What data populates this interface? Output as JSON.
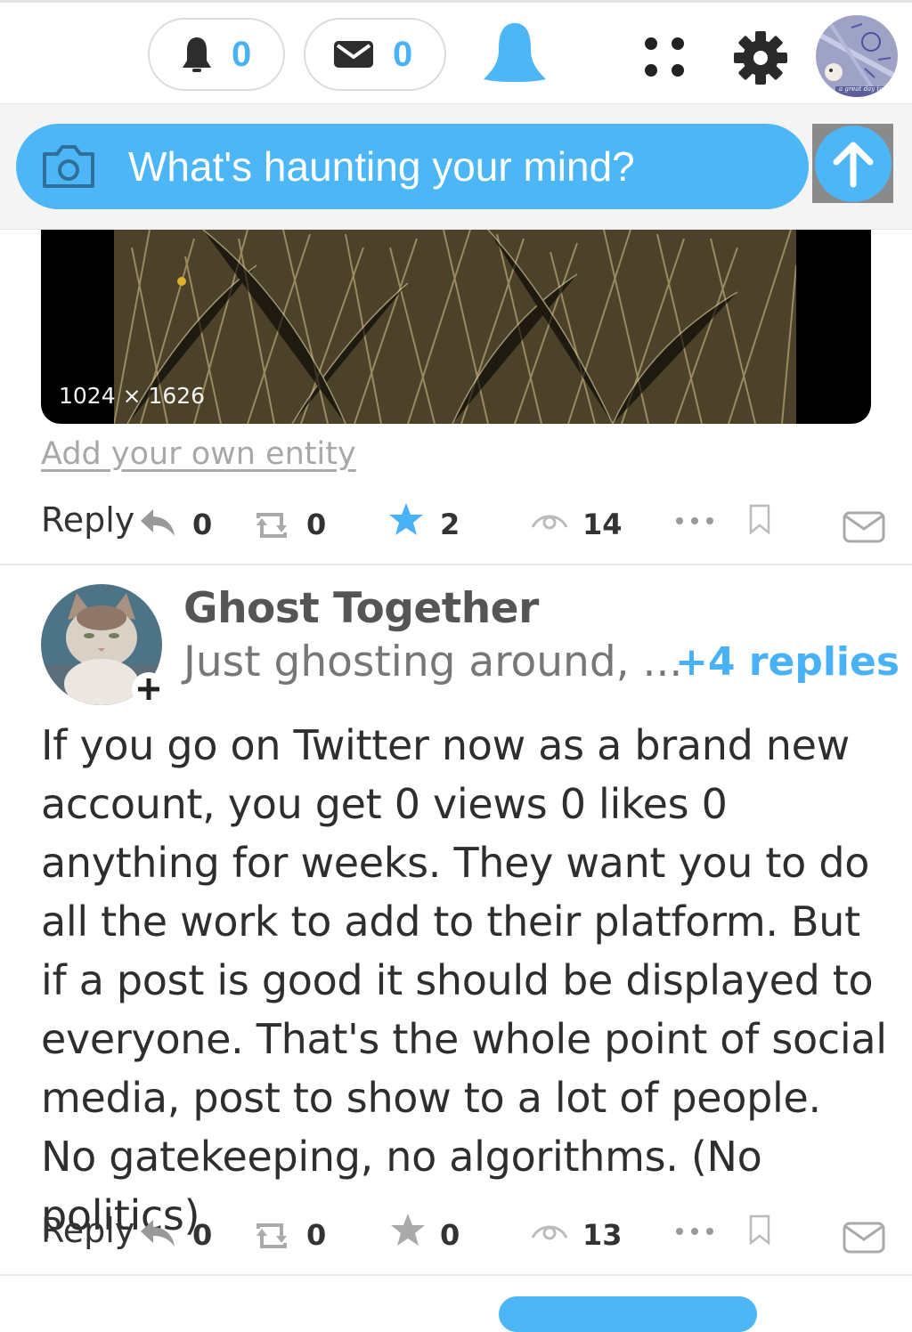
{
  "topbar": {
    "notifications_count": "0",
    "messages_count": "0"
  },
  "composer": {
    "placeholder": "What's haunting your mind?"
  },
  "media": {
    "dimensions_label": "1024 × 1626"
  },
  "first_post": {
    "add_entity_link": "Add your own entity",
    "actions": {
      "reply_label": "Reply",
      "reply_count": "0",
      "repost_count": "0",
      "star_count": "2",
      "view_count": "14"
    }
  },
  "post": {
    "author_name": "Ghost Together",
    "author_tagline": "Just ghosting around, ...",
    "replies_link": "+4 replies",
    "body": "If you go on Twitter now as a brand new account, you get 0 views 0 likes 0 anything for weeks. They want you to do all the work to add to their platform. But if a post is good it should be displayed to everyone. That's the whole point of social media, post to show to a lot of people. No gatekeeping, no algorithms. (No politics)",
    "actions": {
      "reply_label": "Reply",
      "reply_count": "0",
      "repost_count": "0",
      "star_count": "0",
      "view_count": "13"
    }
  },
  "avatar_badge_text": "a great day to",
  "colors": {
    "accent": "#4db6f7",
    "accent_text": "#49b1f5",
    "icon_gray": "#333333"
  }
}
